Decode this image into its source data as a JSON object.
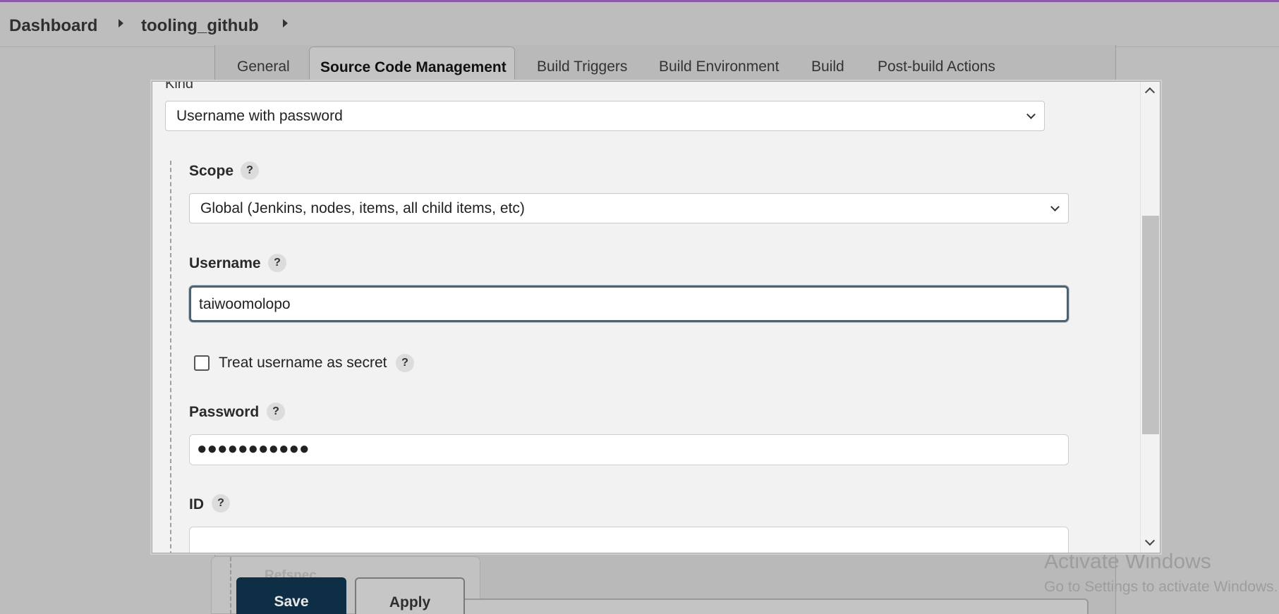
{
  "breadcrumb": {
    "items": [
      "Dashboard",
      "tooling_github"
    ]
  },
  "tabs": {
    "items": [
      "General",
      "Source Code Management",
      "Build Triggers",
      "Build Environment",
      "Build",
      "Post-build Actions"
    ],
    "active": "Source Code Management"
  },
  "dialog": {
    "kind_label": "Kind",
    "kind_value": "Username with password",
    "scope_label": "Scope",
    "scope_value": "Global (Jenkins, nodes, items, all child items, etc)",
    "username_label": "Username",
    "username_value": "taiwoomolopo",
    "treat_secret_label": "Treat username as secret",
    "treat_secret_checked": false,
    "password_label": "Password",
    "password_masked": "●●●●●●●●●●●",
    "id_label": "ID",
    "id_value": "",
    "help_glyph": "?"
  },
  "background": {
    "refspec_label": "Refspec",
    "save_label": "Save",
    "apply_label": "Apply"
  },
  "watermark": {
    "title": "Activate Windows",
    "subtitle": "Go to Settings to activate Windows."
  },
  "colors": {
    "save_button_bg": "#0d2e44",
    "focus_border": "#4e6270",
    "overlay_bg": "#bdbdbd",
    "dialog_bg": "#f2f2f2",
    "top_strip": "#8a5aa6"
  }
}
